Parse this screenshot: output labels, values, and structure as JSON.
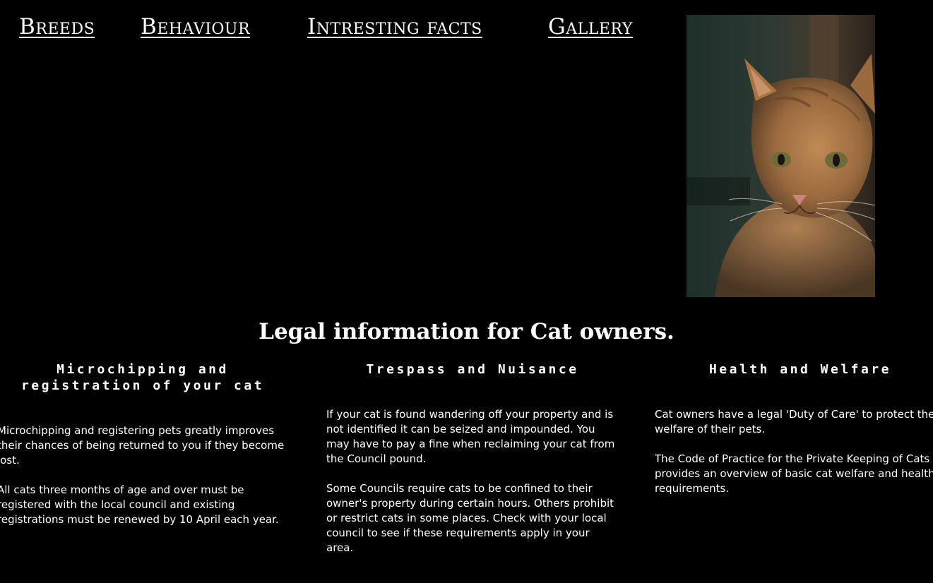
{
  "nav": {
    "items": [
      {
        "label": "Breeds"
      },
      {
        "label": "Behaviour"
      },
      {
        "label": "Intresting facts"
      },
      {
        "label": "Gallery"
      }
    ]
  },
  "hero": {
    "image_alt": "Ginger tabby cat"
  },
  "main": {
    "title": "Legal information for Cat owners.",
    "columns": [
      {
        "heading": "Microchipping and registration of your cat",
        "paragraphs": [
          "Microchipping and registering pets greatly improves their chances of being returned to you if they become lost.",
          "All cats three months of age and over must be registered with the local council and existing registrations must be renewed by 10 April each year."
        ]
      },
      {
        "heading": "Trespass and Nuisance",
        "paragraphs": [
          "If your cat is found wandering off your property and is not identified it can be seized and impounded. You may have to pay a fine when reclaiming your cat from the Council pound.",
          "Some Councils require cats to be confined to their owner's property during certain hours. Others prohibit or restrict cats in some places. Check with your local council to see if these requirements apply in your area."
        ]
      },
      {
        "heading": "Health and Welfare",
        "paragraphs": [
          "Cat owners have a legal 'Duty of Care' to protect the welfare of their pets.",
          "The Code of Practice for the Private Keeping of Cats provides an overview of basic cat welfare and health requirements."
        ]
      }
    ]
  },
  "colors": {
    "background": "#000000",
    "text": "#ffffff"
  }
}
